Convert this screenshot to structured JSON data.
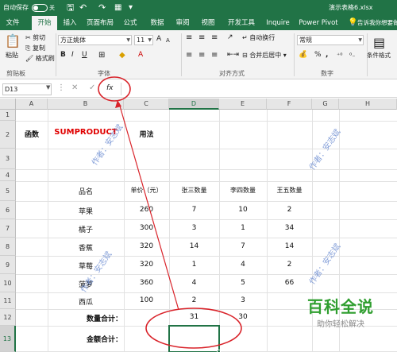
{
  "titlebar": {
    "autosave_label": "自动保存",
    "autosave_state": "关",
    "filename": "演示表格6.xlsx"
  },
  "tabs": [
    "文件",
    "开始",
    "插入",
    "页面布局",
    "公式",
    "数据",
    "审阅",
    "视图",
    "开发工具",
    "Inquire",
    "Power Pivot"
  ],
  "tell_me": "告诉我你想要做什么",
  "ribbon": {
    "paste": "粘贴",
    "cut": "剪切",
    "copy": "复制",
    "format_painter": "格式刷",
    "clipboard_label": "剪贴板",
    "font_name": "方正姚体",
    "font_size": "11",
    "font_label": "字体",
    "wrap_text": "自动换行",
    "merge_center": "合并后居中",
    "alignment_label": "对齐方式",
    "number_format": "常规",
    "number_label": "数字",
    "conditional_format": "条件格式",
    "bold": "B",
    "italic": "I",
    "underline": "U",
    "percent": "%",
    "comma": ",",
    "font_grow": "A",
    "font_shrink": "A"
  },
  "formula_bar": {
    "name_box": "D13",
    "cancel": "✕",
    "enter": "✓",
    "fx": "fx",
    "formula": ""
  },
  "columns": [
    "A",
    "B",
    "C",
    "D",
    "E",
    "F",
    "G",
    "H"
  ],
  "rows": [
    "1",
    "2",
    "3",
    "4",
    "5",
    "6",
    "7",
    "8",
    "9",
    "10",
    "11",
    "12",
    "13"
  ],
  "cells": {
    "A2": "函数",
    "B2": "SUMPRODUCT",
    "C2": "用法",
    "B5": "品名",
    "C5": "单价（元）",
    "D5": "张三数量",
    "E5": "李四数量",
    "F5": "王五数量",
    "B6": "苹果",
    "C6": "260",
    "D6": "7",
    "E6": "10",
    "F6": "2",
    "B7": "橘子",
    "C7": "300",
    "D7": "3",
    "E7": "1",
    "F7": "34",
    "B8": "香蕉",
    "C8": "320",
    "D8": "14",
    "E8": "7",
    "F8": "14",
    "B9": "草莓",
    "C9": "320",
    "D9": "1",
    "E9": "4",
    "F9": "2",
    "B10": "菠萝",
    "C10": "360",
    "D10": "4",
    "E10": "5",
    "F10": "66",
    "B11": "西瓜",
    "C11": "100",
    "D11": "2",
    "E11": "3",
    "F11": "",
    "B12": "数量合计：",
    "D12": "31",
    "E12": "30",
    "B13": "金额合计：",
    "D13": ""
  },
  "watermarks": [
    "作者：安志斌",
    "作者：安志斌",
    "作者：安志斌",
    "作者：安志斌"
  ],
  "brand": {
    "name": "百科全说",
    "tagline": "助你轻松解决"
  },
  "colors": {
    "excel_green": "#217346",
    "annotation_red": "#d9232a",
    "function_red": "#e00000"
  }
}
